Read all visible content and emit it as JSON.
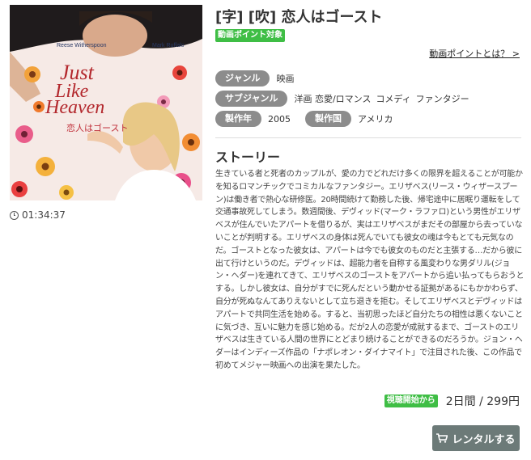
{
  "poster": {
    "actor_left": "Reese Witherspoon",
    "actor_right": "Mark Ruffalo",
    "logo_line1": "Just",
    "logo_line2": "Like",
    "logo_line3": "Heaven",
    "logo_jp": "恋人はゴースト"
  },
  "duration": "01:34:37",
  "title": "[字] [吹] 恋人はゴースト",
  "point_badge": "動画ポイント対象",
  "point_link": "動画ポイントとは？ >",
  "meta": {
    "genre_label": "ジャンル",
    "genre_value": "映画",
    "subgenre_label": "サブジャンル",
    "subgenres": [
      "洋画 恋愛/ロマンス",
      "コメディ",
      "ファンタジー"
    ],
    "year_label": "製作年",
    "year_value": "2005",
    "country_label": "製作国",
    "country_value": "アメリカ"
  },
  "story": {
    "heading": "ストーリー",
    "text": "生きている者と死者のカップルが、愛の力でどれだけ多くの限界を超えることが可能かを知るロマンチックでコミカルなファンタジー。エリザベス(リース・ウィザースプーン)は働き者で熱心な研修医。20時間続けて勤務した後、帰宅途中に居眠り運転をして交通事故死してしまう。数週間後、デヴィッド(マーク・ラファロ)という男性がエリザベスが住んでいたアパートを借りるが、実はエリザベスがまだその部屋から去っていないことが判明する。エリザベスの身体は死んでいても彼女の魂は今もとても元気なのだ。ゴーストとなった彼女は、アパートは今でも彼女のものだと主張する…だから彼に出て行けというのだ。デヴィッドは、超能力者を自称する風変わりな男ダリル(ジョン・ヘダー)を連れてきて、エリザベスのゴーストをアパートから追い払ってもらおうとする。しかし彼女は、自分がすでに死んだという動かせる証拠があるにもかかわらず、自分が死ぬなんてありえないとして立ち退きを拒む。そしてエリザベスとデヴィッドはアパートで共同生活を始める。すると、当初思ったほど自分たちの相性は悪くないことに気づき、互いに魅力を感じ始める。だが2人の恋愛が成就するまで、ゴーストのエリザベスは生きている人間の世界にとどまり続けることができるのだろうか。ジョン・ヘダーはインディーズ作品の「ナポレオン・ダイナマイト」で注目された後、この作品で初めてメジャー映画への出演を果たした。"
  },
  "rental": {
    "start_badge": "視聴開始から",
    "price": "2日間 / 299円",
    "button_label": "レンタルする"
  },
  "colors": {
    "accent_green": "#3fbe45",
    "pill_gray": "#8c8c8c",
    "button_gray": "#6c7a78"
  }
}
